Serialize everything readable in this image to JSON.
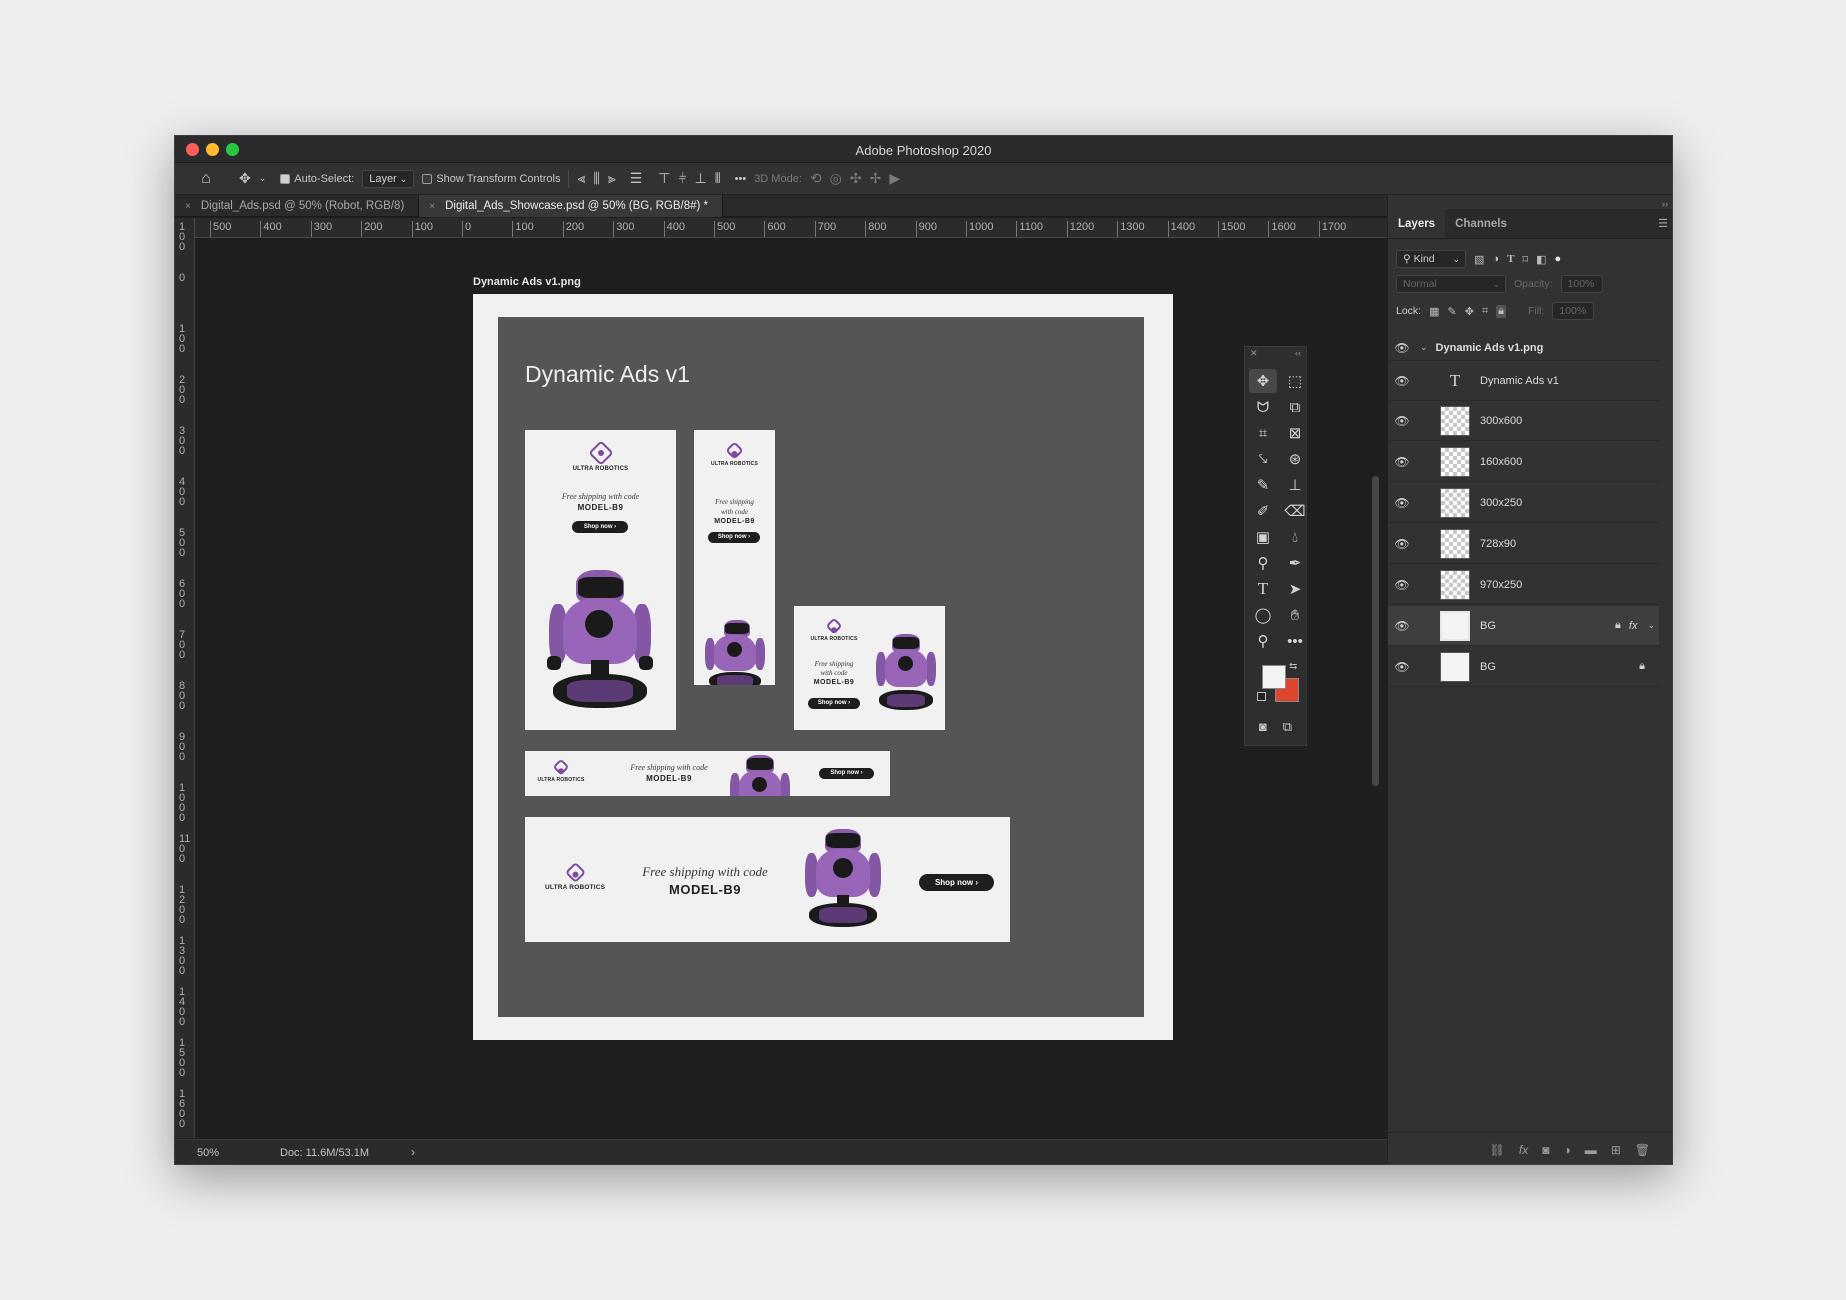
{
  "window": {
    "title": "Adobe Photoshop 2020"
  },
  "options": {
    "auto_select_label": "Auto-Select:",
    "auto_select_value": "Layer",
    "show_transform_label": "Show Transform Controls",
    "more": "•••",
    "mode_3d_label": "3D Mode:"
  },
  "tabs": [
    {
      "label": "Digital_Ads.psd @ 50% (Robot, RGB/8)",
      "close": "×"
    },
    {
      "label": "Digital_Ads_Showcase.psd @ 50% (BG, RGB/8#) *",
      "close": "×"
    }
  ],
  "ruler": {
    "h": [
      "500",
      "400",
      "300",
      "200",
      "100",
      "0",
      "100",
      "200",
      "300",
      "400",
      "500",
      "600",
      "700",
      "800",
      "900",
      "1000",
      "1100",
      "1200",
      "1300",
      "1400",
      "1500",
      "1600",
      "1700"
    ],
    "v": [
      "100",
      "0",
      "100",
      "200",
      "300",
      "400",
      "500",
      "600",
      "700",
      "800",
      "900",
      "1000",
      "1100",
      "1200",
      "1300",
      "1400",
      "1500",
      "1600"
    ]
  },
  "artboard": {
    "label": "Dynamic Ads v1.png",
    "title": "Dynamic Ads v1"
  },
  "ad": {
    "brand": "ULTRA ROBOTICS",
    "headline": "Free shipping with code",
    "code": "MODEL-B9",
    "cta": "Shop now ›",
    "headline_160": [
      "Free shipping",
      "with code"
    ]
  },
  "status": {
    "zoom": "50%",
    "doc": "Doc: 11.6M/53.1M",
    "arrow": "›"
  },
  "panel": {
    "tabs": [
      "Layers",
      "Channels"
    ],
    "kind": "Kind",
    "blend": "Normal",
    "opacity_label": "Opacity:",
    "opacity_value": "100%",
    "lock_label": "Lock:",
    "fill_label": "Fill:",
    "fill_value": "100%",
    "layers": [
      {
        "name": "Dynamic Ads v1.png"
      },
      {
        "name": "Dynamic Ads v1"
      },
      {
        "name": "300x600"
      },
      {
        "name": "160x600"
      },
      {
        "name": "300x250"
      },
      {
        "name": "728x90"
      },
      {
        "name": "970x250"
      },
      {
        "name": "BG",
        "fx": "fx"
      },
      {
        "name": "BG"
      }
    ]
  },
  "colors": {
    "accent_purple": "#8b5aaa",
    "foreground": "#f4f4f4",
    "background": "#e0462e"
  }
}
